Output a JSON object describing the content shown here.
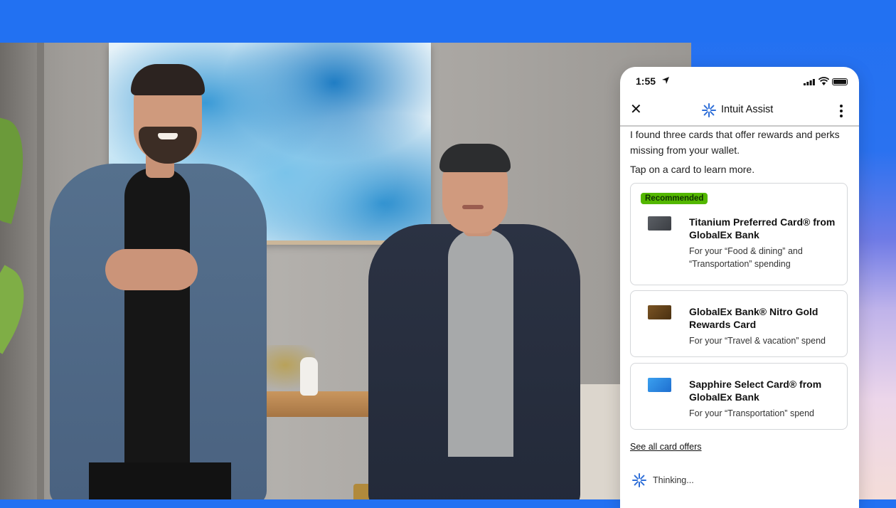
{
  "colors": {
    "brand_blue": "#2271f2",
    "badge_green": "#53b700",
    "card_border": "#d4d6d9"
  },
  "status_bar": {
    "time": "1:55",
    "icons": [
      "location-arrow-icon",
      "signal-icon",
      "wifi-icon",
      "battery-icon"
    ]
  },
  "header": {
    "close_icon": "close-icon",
    "brand_icon": "intuit-assist-icon",
    "title": "Intuit Assist",
    "menu_icon": "more-vertical-icon"
  },
  "chat": {
    "message_1": "I found three cards that offer rewards and perks missing from your wallet.",
    "message_2": "Tap on a card to learn more."
  },
  "cards": [
    {
      "badge": "Recommended",
      "title": "Titanium Preferred Card® from GlobalEx Bank",
      "description": "For your “Food & dining” and “Transportation” spending",
      "card_color": "#4a4d52"
    },
    {
      "badge": "",
      "title": "GlobalEx Bank® Nitro Gold Rewards Card",
      "description": "For your “Travel & vacation” spend",
      "card_color": "#6b4a1f"
    },
    {
      "badge": "",
      "title": "Sapphire Select Card® from GlobalEx Bank",
      "description": "For your “Transportation” spend",
      "card_color": "#2a8be3"
    }
  ],
  "links": {
    "see_all": "See all card offers"
  },
  "status": {
    "thinking": "Thinking..."
  }
}
